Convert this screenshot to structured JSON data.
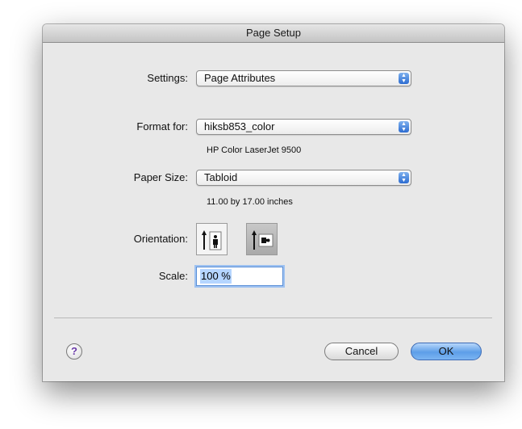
{
  "window": {
    "title": "Page Setup"
  },
  "settings": {
    "label": "Settings:",
    "value": "Page Attributes"
  },
  "format_for": {
    "label": "Format for:",
    "value": "hiksb853_color",
    "printer_name": "HP Color LaserJet 9500"
  },
  "paper_size": {
    "label": "Paper Size:",
    "value": "Tabloid",
    "dimensions": "11.00 by 17.00 inches"
  },
  "orientation": {
    "label": "Orientation:",
    "selected": "landscape"
  },
  "scale": {
    "label": "Scale:",
    "value": "100 %"
  },
  "buttons": {
    "help": "?",
    "cancel": "Cancel",
    "ok": "OK"
  },
  "colors": {
    "accent": "#4a8ae0",
    "window_bg": "#e8e8e8"
  }
}
